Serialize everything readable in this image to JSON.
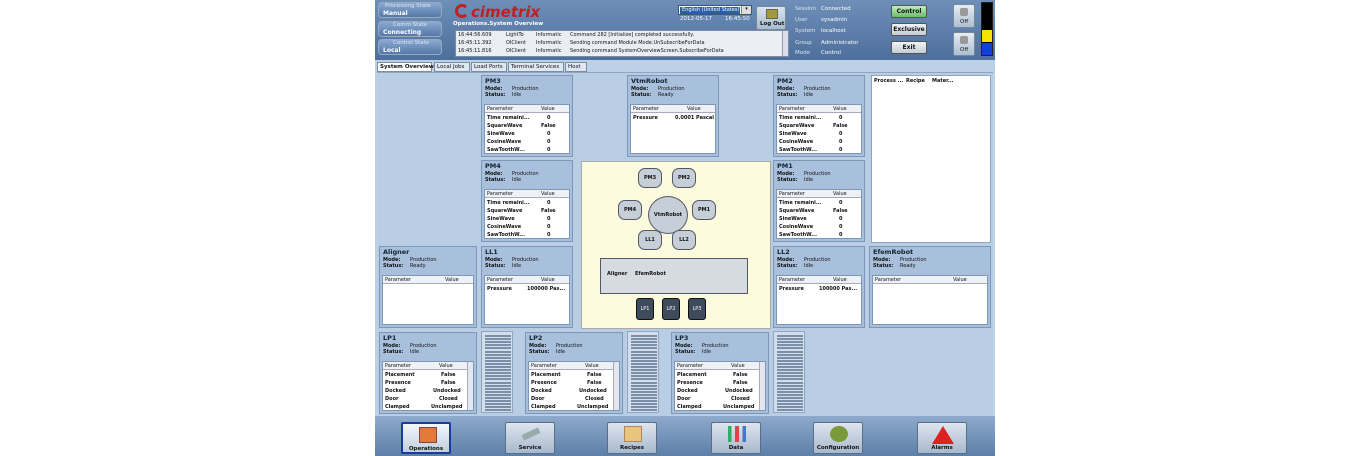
{
  "header": {
    "processing_state": {
      "title": "Processing State",
      "value": "Manual"
    },
    "comm_state": {
      "title": "Comm State",
      "value": "Connecting"
    },
    "control_state": {
      "title": "Control State",
      "value": "Local"
    },
    "logo_text": "cimetrix",
    "screen_title": "Operations.System Overview",
    "language": "English (United States)",
    "date": "2012-05-17",
    "time": "16:45:50",
    "logout_label": "Log Out",
    "messages": [
      {
        "time": "16:44:56.609",
        "source": "LightTo",
        "type": "Informatic",
        "text": "Command 282 [Initialize] completed successfully."
      },
      {
        "time": "16:45:11.392",
        "source": "OIClient",
        "type": "Informatic",
        "text": "Sending command Module Mode.UnSubscribeForData"
      },
      {
        "time": "16:45:11.816",
        "source": "OIClient",
        "type": "Informatic",
        "text": "Sending command SystemOverviewScreen.SubscribeForData"
      }
    ],
    "session": [
      {
        "key": "Session",
        "value": "Connected"
      },
      {
        "key": "User",
        "value": "sysadmin"
      },
      {
        "key": "System",
        "value": "localhost"
      },
      {
        "key": "Group",
        "value": "Administrator"
      },
      {
        "key": "Mode",
        "value": "Control"
      }
    ],
    "control_buttons": [
      "Control",
      "Exclusive",
      "Exit"
    ],
    "toggles": [
      "Off",
      "Off"
    ],
    "signal_colors": [
      "#000000",
      "#000000",
      "#f5e400",
      "#1040e0"
    ]
  },
  "tabs": [
    "System Overview",
    "Local Jobs",
    "Load Ports",
    "Terminal Services",
    "Host"
  ],
  "labels": {
    "mode": "Mode:",
    "status": "Status:",
    "parameter": "Parameter",
    "value": "Value"
  },
  "modules": {
    "pm3": {
      "title": "PM3",
      "mode": "Production",
      "status": "Idle",
      "rows": [
        [
          "Time remaini...",
          "0"
        ],
        [
          "SquareWave",
          "False"
        ],
        [
          "SineWave",
          "0"
        ],
        [
          "CosineWave",
          "0"
        ],
        [
          "SawToothW...",
          "0"
        ]
      ]
    },
    "pm4": {
      "title": "PM4",
      "mode": "Production",
      "status": "Idle",
      "rows": [
        [
          "Time remaini...",
          "0"
        ],
        [
          "SquareWave",
          "False"
        ],
        [
          "SineWave",
          "0"
        ],
        [
          "CosineWave",
          "0"
        ],
        [
          "SawToothW...",
          "0"
        ]
      ]
    },
    "vtm": {
      "title": "VtmRobot",
      "mode": "Production",
      "status": "Ready",
      "rows": [
        [
          "Pressure",
          "0.0001 Pascal"
        ]
      ]
    },
    "pm2": {
      "title": "PM2",
      "mode": "Production",
      "status": "Idle",
      "rows": [
        [
          "Time remaini...",
          "0"
        ],
        [
          "SquareWave",
          "False"
        ],
        [
          "SineWave",
          "0"
        ],
        [
          "CosineWave",
          "0"
        ],
        [
          "SawToothW...",
          "0"
        ]
      ]
    },
    "pm1": {
      "title": "PM1",
      "mode": "Production",
      "status": "Idle",
      "rows": [
        [
          "Time remaini...",
          "0"
        ],
        [
          "SquareWave",
          "False"
        ],
        [
          "SineWave",
          "0"
        ],
        [
          "CosineWave",
          "0"
        ],
        [
          "SawToothW...",
          "0"
        ]
      ]
    },
    "aligner": {
      "title": "Aligner",
      "mode": "Production",
      "status": "Ready",
      "rows": []
    },
    "ll1": {
      "title": "LL1",
      "mode": "Production",
      "status": "Idle",
      "rows": [
        [
          "Pressure",
          "100000 Pas..."
        ]
      ]
    },
    "ll2": {
      "title": "LL2",
      "mode": "Production",
      "status": "Idle",
      "rows": [
        [
          "Pressure",
          "100000 Pas..."
        ]
      ]
    },
    "efem": {
      "title": "EfemRobot",
      "mode": "Production",
      "status": "Ready",
      "rows": []
    },
    "lp1": {
      "title": "LP1",
      "mode": "Production",
      "status": "Idle",
      "rows": [
        [
          "Placement",
          "False"
        ],
        [
          "Presence",
          "False"
        ],
        [
          "Docked",
          "Undocked"
        ],
        [
          "Door",
          "Closed"
        ],
        [
          "Clamped",
          "Unclamped"
        ]
      ]
    },
    "lp2": {
      "title": "LP2",
      "mode": "Production",
      "status": "Idle",
      "rows": [
        [
          "Placement",
          "False"
        ],
        [
          "Presence",
          "False"
        ],
        [
          "Docked",
          "Undocked"
        ],
        [
          "Door",
          "Closed"
        ],
        [
          "Clamped",
          "Unclamped"
        ]
      ]
    },
    "lp3": {
      "title": "LP3",
      "mode": "Production",
      "status": "Idle",
      "rows": [
        [
          "Placement",
          "False"
        ],
        [
          "Presence",
          "False"
        ],
        [
          "Docked",
          "Undocked"
        ],
        [
          "Door",
          "Closed"
        ],
        [
          "Clamped",
          "Unclamped"
        ]
      ]
    }
  },
  "process_list_headers": [
    "Process ...",
    "Recipe",
    "Mater..."
  ],
  "diagram": {
    "nodes": [
      "PM3",
      "PM2",
      "PM4",
      "PM1",
      "LL1",
      "LL2"
    ],
    "robot": "VtmRobot",
    "aligner": "Aligner",
    "efem_robot": "EfemRobot",
    "load_ports": [
      "LP1",
      "LP2",
      "LP3"
    ]
  },
  "nav": [
    "Operations",
    "Service",
    "Recipes",
    "Data",
    "Configuration",
    "Alarms"
  ]
}
